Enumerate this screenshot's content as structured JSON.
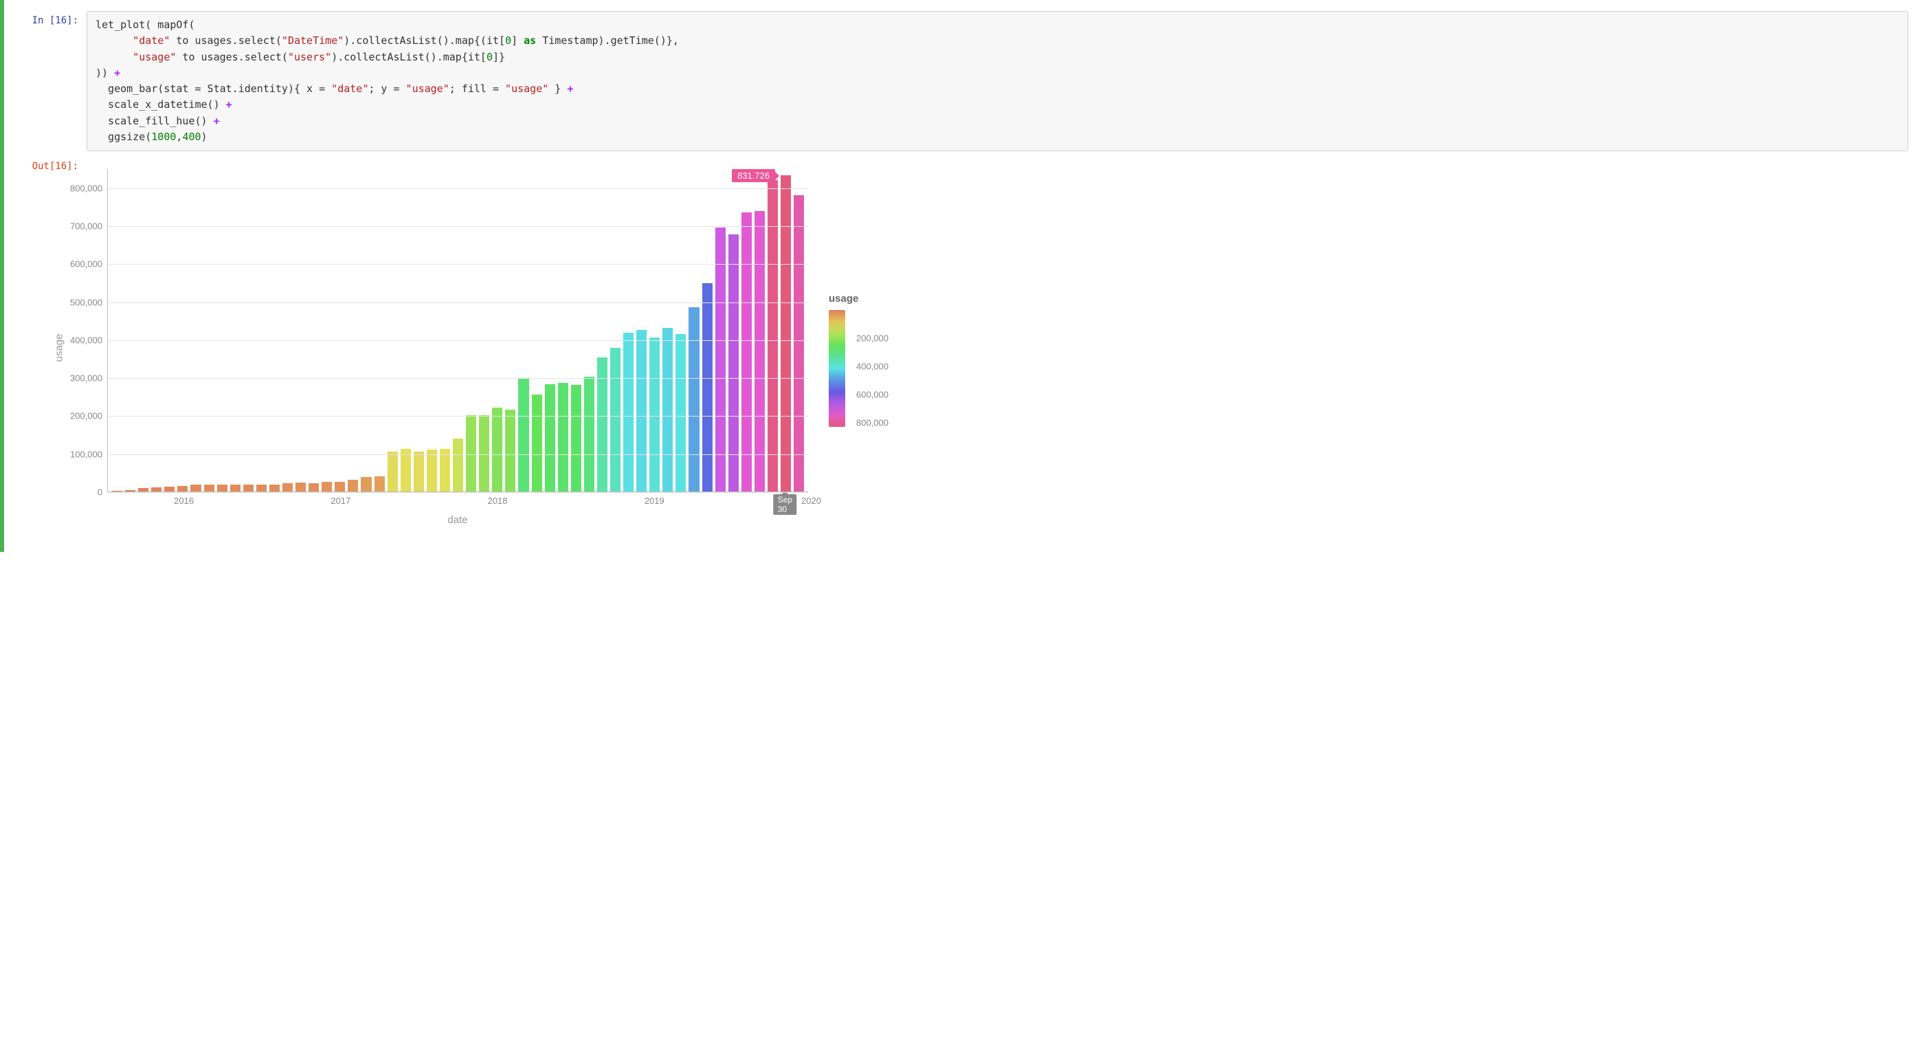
{
  "in_prompt": "In [16]:",
  "out_prompt": "Out[16]:",
  "code": {
    "l1a": "let_plot( mapOf(",
    "l2a": "      ",
    "l2s1": "\"date\"",
    "l2b": " to usages.select(",
    "l2s2": "\"DateTime\"",
    "l2c": ").collectAsList().map{(it[",
    "l2n1": "0",
    "l2d": "] ",
    "l2kw": "as",
    "l2e": " Timestamp).getTime()},",
    "l3a": "      ",
    "l3s1": "\"usage\"",
    "l3b": " to usages.select(",
    "l3s2": "\"users\"",
    "l3c": ").collectAsList().map{it[",
    "l3n1": "0",
    "l3d": "]}",
    "l4a": ")) ",
    "l4op": "+",
    "l5a": "  geom_bar(stat = Stat.identity){ x = ",
    "l5s1": "\"date\"",
    "l5b": "; y = ",
    "l5s2": "\"usage\"",
    "l5c": "; fill = ",
    "l5s3": "\"usage\"",
    "l5d": " } ",
    "l5op": "+",
    "l6a": "  scale_x_datetime() ",
    "l6op": "+",
    "l7a": "  scale_fill_hue() ",
    "l7op": "+",
    "l8a": "  ggsize(",
    "l8n1": "1000",
    "l8b": ",",
    "l8n2": "400",
    "l8c": ")"
  },
  "tooltip_value": "831.726",
  "tooltip_x": "Sep 30",
  "legend": {
    "title": "usage",
    "ticks": [
      "200,000",
      "400,000",
      "600,000",
      "800,000"
    ]
  },
  "yticks": [
    "0",
    "100,000",
    "200,000",
    "300,000",
    "400,000",
    "500,000",
    "600,000",
    "700,000",
    "800,000"
  ],
  "xticks": [
    "2016",
    "2017",
    "2018",
    "2019",
    "2020"
  ],
  "chart_data": {
    "type": "bar",
    "xlabel": "date",
    "ylabel": "usage",
    "ylim": [
      0,
      850000
    ],
    "highlight": {
      "index": 51,
      "label": "831.726",
      "xlabel": "Sep 30"
    },
    "x_year_positions": {
      "2016": 5,
      "2017": 17,
      "2018": 29,
      "2019": 41,
      "2020": 53
    },
    "categories": [
      "2015-08",
      "2015-09",
      "2015-10",
      "2015-11",
      "2015-12",
      "2016-01",
      "2016-02",
      "2016-03",
      "2016-04",
      "2016-05",
      "2016-06",
      "2016-07",
      "2016-08",
      "2016-09",
      "2016-10",
      "2016-11",
      "2016-12",
      "2017-01",
      "2017-02",
      "2017-03",
      "2017-04",
      "2017-05",
      "2017-06",
      "2017-07",
      "2017-08",
      "2017-09",
      "2017-10",
      "2017-11",
      "2017-12",
      "2018-01",
      "2018-02",
      "2018-03",
      "2018-04",
      "2018-05",
      "2018-06",
      "2018-07",
      "2018-08",
      "2018-09",
      "2018-10",
      "2018-11",
      "2018-12",
      "2019-01",
      "2019-02",
      "2019-03",
      "2019-04",
      "2019-05",
      "2019-06",
      "2019-07",
      "2019-08",
      "2019-09",
      "2019-10",
      "2019-11",
      "2019-12"
    ],
    "values": [
      1000,
      3000,
      9000,
      10000,
      12000,
      15000,
      19000,
      19000,
      18000,
      18000,
      19000,
      18000,
      19000,
      22000,
      24000,
      22000,
      25000,
      25000,
      30000,
      38000,
      40000,
      105000,
      112000,
      105000,
      110000,
      113000,
      140000,
      200000,
      200000,
      220000,
      215000,
      298000,
      255000,
      282000,
      285000,
      280000,
      302000,
      353000,
      378000,
      418000,
      425000,
      405000,
      430000,
      415000,
      485000,
      548000,
      695000,
      676000,
      735000,
      738000,
      820000,
      831726,
      780000
    ]
  }
}
